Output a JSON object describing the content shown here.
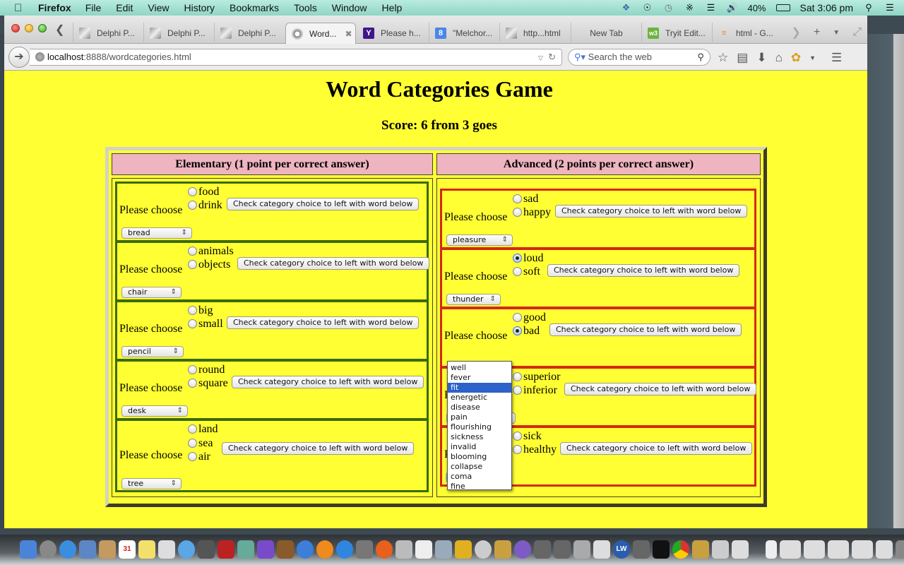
{
  "menubar": {
    "app_name": "Firefox",
    "items": [
      "File",
      "Edit",
      "View",
      "History",
      "Bookmarks",
      "Tools",
      "Window",
      "Help"
    ],
    "battery": "40%",
    "clock": "Sat 3:06 pm"
  },
  "browser": {
    "tabs": [
      {
        "label": "Delphi P...",
        "icon": "image-thumbnail-icon",
        "active": false
      },
      {
        "label": "Delphi P...",
        "icon": "image-thumbnail-icon",
        "active": false
      },
      {
        "label": "Delphi P...",
        "icon": "image-thumbnail-icon",
        "active": false
      },
      {
        "label": "Word...",
        "icon": "globe-icon",
        "active": true
      },
      {
        "label": "Please h...",
        "icon": "yahoo-icon",
        "active": false
      },
      {
        "label": "\"Melchor...",
        "icon": "google-icon",
        "active": false
      },
      {
        "label": "http...html",
        "icon": "image-thumbnail-icon",
        "active": false
      },
      {
        "label": "New Tab",
        "icon": "",
        "active": false
      },
      {
        "label": "Tryit Edit...",
        "icon": "w3schools-icon",
        "active": false
      },
      {
        "label": "html - G...",
        "icon": "stackoverflow-icon",
        "active": false
      }
    ],
    "url_host": "localhost",
    "url_path": ":8888/wordcategories.html",
    "search_placeholder": "Search the web"
  },
  "page": {
    "title": "Word Categories Game",
    "score": "Score: 6 from 3 goes",
    "please_choose": "Please choose",
    "check_button": "Check category choice to left with word below",
    "elementary": {
      "header": "Elementary (1 point per correct answer)",
      "questions": [
        {
          "options": [
            "food",
            "drink"
          ],
          "checked": null,
          "word": "bread"
        },
        {
          "options": [
            "animals",
            "objects"
          ],
          "checked": null,
          "word": "chair"
        },
        {
          "options": [
            "big",
            "small"
          ],
          "checked": null,
          "word": "pencil"
        },
        {
          "options": [
            "round",
            "square"
          ],
          "checked": null,
          "word": "desk"
        },
        {
          "options": [
            "land",
            "sea",
            "air"
          ],
          "checked": null,
          "word": "tree"
        }
      ]
    },
    "advanced": {
      "header": "Advanced (2 points per correct answer)",
      "questions": [
        {
          "options": [
            "sad",
            "happy"
          ],
          "checked": null,
          "word": "pleasure"
        },
        {
          "options": [
            "loud",
            "soft"
          ],
          "checked": "loud",
          "word": "thunder"
        },
        {
          "options": [
            "good",
            "bad"
          ],
          "checked": "bad",
          "word": ""
        },
        {
          "options": [
            "superior",
            "inferior"
          ],
          "checked": null,
          "word": ""
        },
        {
          "options": [
            "sick",
            "healthy"
          ],
          "checked": null,
          "word": "fit"
        }
      ]
    },
    "open_dropdown": {
      "options": [
        "well",
        "fever",
        "fit",
        "energetic",
        "disease",
        "pain",
        "flourishing",
        "sickness",
        "invalid",
        "blooming",
        "collapse",
        "coma",
        "fine"
      ],
      "selected": "fit"
    }
  }
}
